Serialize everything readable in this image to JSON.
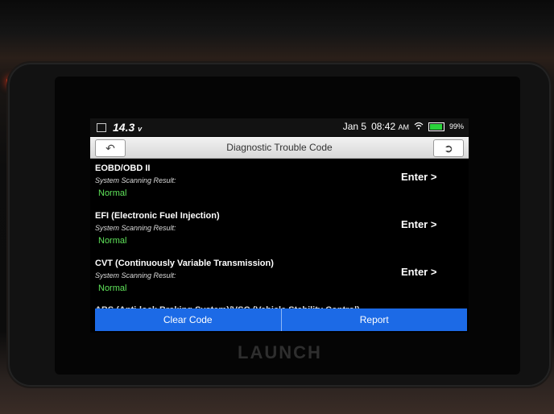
{
  "status_bar": {
    "voltage": "14.3",
    "voltage_unit": "v",
    "date": "Jan 5",
    "time": "08:42",
    "ampm": "AM",
    "battery": "99%"
  },
  "header": {
    "title": "Diagnostic Trouble Code"
  },
  "systems": [
    {
      "name": "EOBD/OBD II",
      "scan_label": "System Scanning Result:",
      "result": "Normal",
      "action": "Enter >"
    },
    {
      "name": "EFI (Electronic Fuel Injection)",
      "scan_label": "System Scanning Result:",
      "result": "Normal",
      "action": "Enter >"
    },
    {
      "name": "CVT (Continuously Variable Transmission)",
      "scan_label": "System Scanning Result:",
      "result": "Normal",
      "action": "Enter >"
    }
  ],
  "partial_item": "ABS (Anti-lock Braking System)/VSC (Vehicle Stability Control)",
  "footer": {
    "clear_label": "Clear Code",
    "report_label": "Report"
  },
  "device_brand": "LAUNCH",
  "colors": {
    "result_ok": "#5fe35a",
    "action_blue": "#1c6ae6"
  }
}
